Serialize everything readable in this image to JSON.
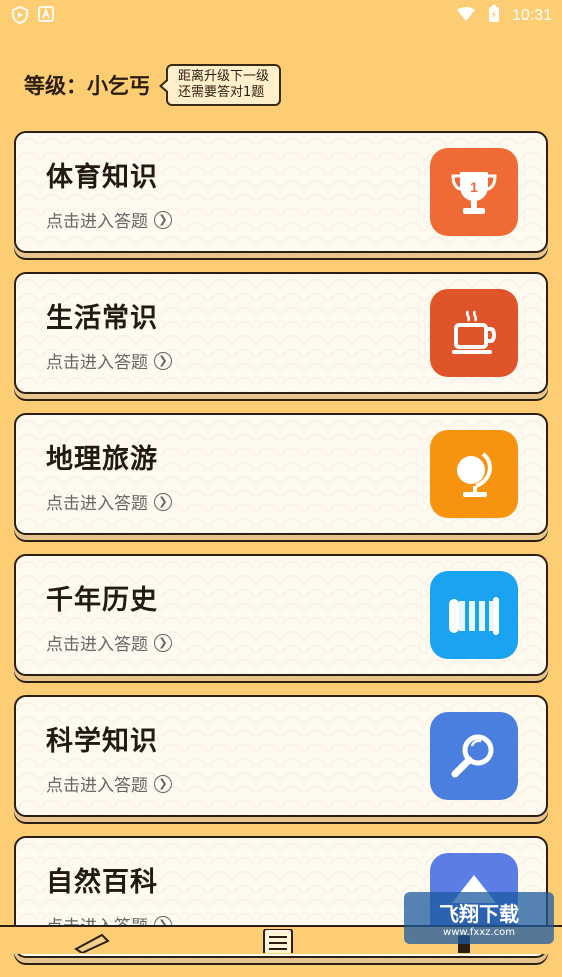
{
  "status_bar": {
    "time": "10:31"
  },
  "header": {
    "level_label": "等级：小乞丐",
    "bubble_line1": "距离升级下一级",
    "bubble_line2": "还需要答对1题"
  },
  "cards": [
    {
      "title": "体育知识",
      "subtitle": "点击进入答题",
      "icon": "trophy-icon",
      "color": "#f06a35"
    },
    {
      "title": "生活常识",
      "subtitle": "点击进入答题",
      "icon": "coffee-cup-icon",
      "color": "#e0542a"
    },
    {
      "title": "地理旅游",
      "subtitle": "点击进入答题",
      "icon": "globe-icon",
      "color": "#f7940f"
    },
    {
      "title": "千年历史",
      "subtitle": "点击进入答题",
      "icon": "scroll-icon",
      "color": "#1aa3f0"
    },
    {
      "title": "科学知识",
      "subtitle": "点击进入答题",
      "icon": "magnifier-icon",
      "color": "#4a7fe0"
    },
    {
      "title": "自然百科",
      "subtitle": "点击进入答题",
      "icon": "mountain-icon",
      "color": "#5a7de6"
    }
  ],
  "watermark": {
    "big": "飞翔下载",
    "small": "www.fxxz.com"
  }
}
